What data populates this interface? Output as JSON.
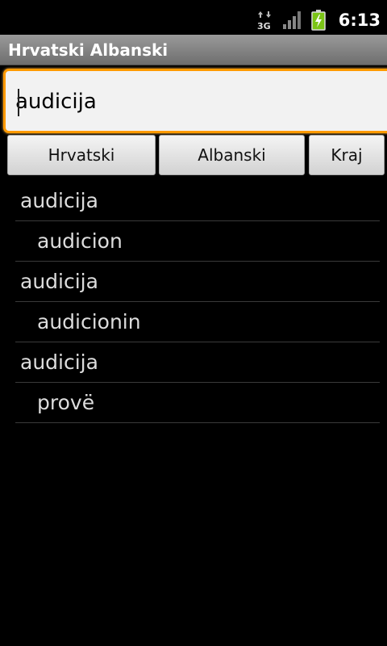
{
  "status_bar": {
    "network_icon": "3g-data-icon",
    "signal_icon": "signal-strength-icon",
    "battery_icon": "battery-charging-icon",
    "network_label": "3G",
    "time": "6:13"
  },
  "titlebar": {
    "title": "Hrvatski Albanski"
  },
  "search": {
    "value": "audicija",
    "placeholder": ""
  },
  "buttons": {
    "hrvatski": "Hrvatski",
    "albanski": "Albanski",
    "kraj": "Kraj"
  },
  "results": [
    {
      "source": "audicija",
      "translation": "audicion"
    },
    {
      "source": "audicija",
      "translation": "audicionin"
    },
    {
      "source": "audicija",
      "translation": "provë"
    }
  ]
}
